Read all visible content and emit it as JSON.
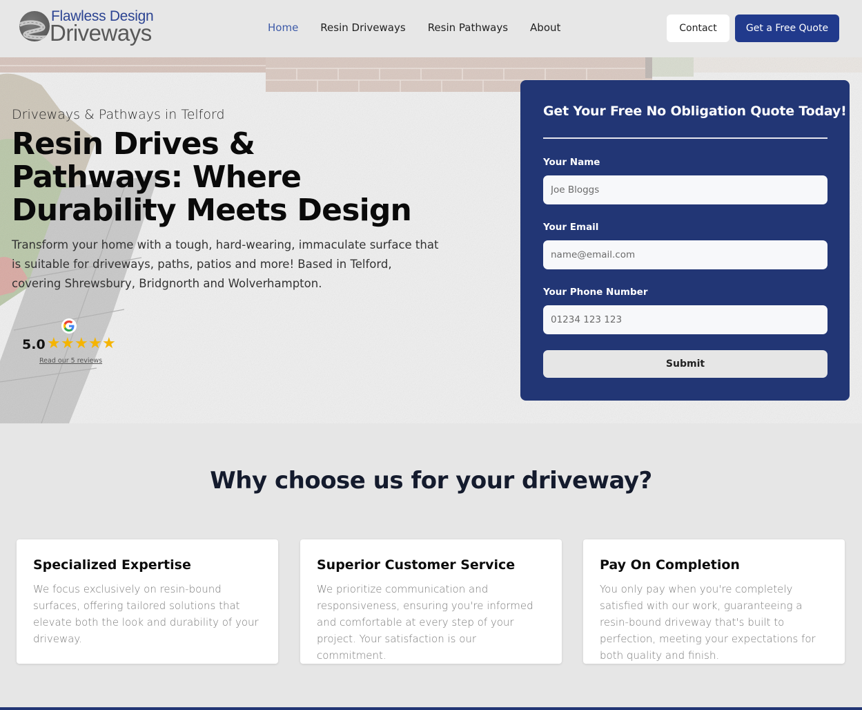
{
  "header": {
    "logo": {
      "line1": "Flawless Design",
      "line2": "Driveways"
    },
    "nav": [
      {
        "label": "Home",
        "active": true
      },
      {
        "label": "Resin Driveways",
        "active": false
      },
      {
        "label": "Resin Pathways",
        "active": false
      },
      {
        "label": "About",
        "active": false
      }
    ],
    "contact_label": "Contact",
    "quote_label": "Get a Free Quote"
  },
  "hero": {
    "subtitle": "Driveways & Pathways in Telford",
    "title": "Resin Drives & Pathways: Where Durability Meets Design",
    "description": "Transform your home with a tough, hard-wearing, immaculate surface that is suitable for driveways, paths, patios and more! Based in Telford, covering Shrewsbury, Bridgnorth and Wolverhampton.",
    "rating": {
      "icon": "google-icon",
      "score": "5.0",
      "stars": 5,
      "stars_max": 5,
      "reviews_link": "Read our 5 reviews"
    }
  },
  "form": {
    "title": "Get Your Free No Obligation Quote Today!",
    "fields": [
      {
        "label": "Your Name",
        "placeholder": "Joe Bloggs",
        "value": ""
      },
      {
        "label": "Your Email",
        "placeholder": "name@email.com",
        "value": ""
      },
      {
        "label": "Your Phone Number",
        "placeholder": "01234 123 123",
        "value": ""
      }
    ],
    "submit_label": "Submit"
  },
  "why": {
    "title": "Why choose us for your driveway?",
    "features": [
      {
        "title": "Specialized Expertise",
        "text": "We focus exclusively on resin-bound surfaces, offering tailored solutions that elevate both the look and durability of your driveway."
      },
      {
        "title": "Superior Customer Service",
        "text": "We prioritize communication and responsiveness, ensuring you're informed and comfortable at every step of your project. Your satisfaction is our commitment."
      },
      {
        "title": "Pay On Completion",
        "text": "You only pay when you're completely satisfied with our work, guaranteeing a resin-bound driveway that's built to perfection, meeting your expectations for both quality and finish."
      }
    ]
  },
  "colors": {
    "brand_navy": "#223675",
    "button_navy": "#213a8c",
    "nav_active": "#3d5aa8",
    "star": "#f5b400",
    "page_bg": "#e6e6e6"
  }
}
